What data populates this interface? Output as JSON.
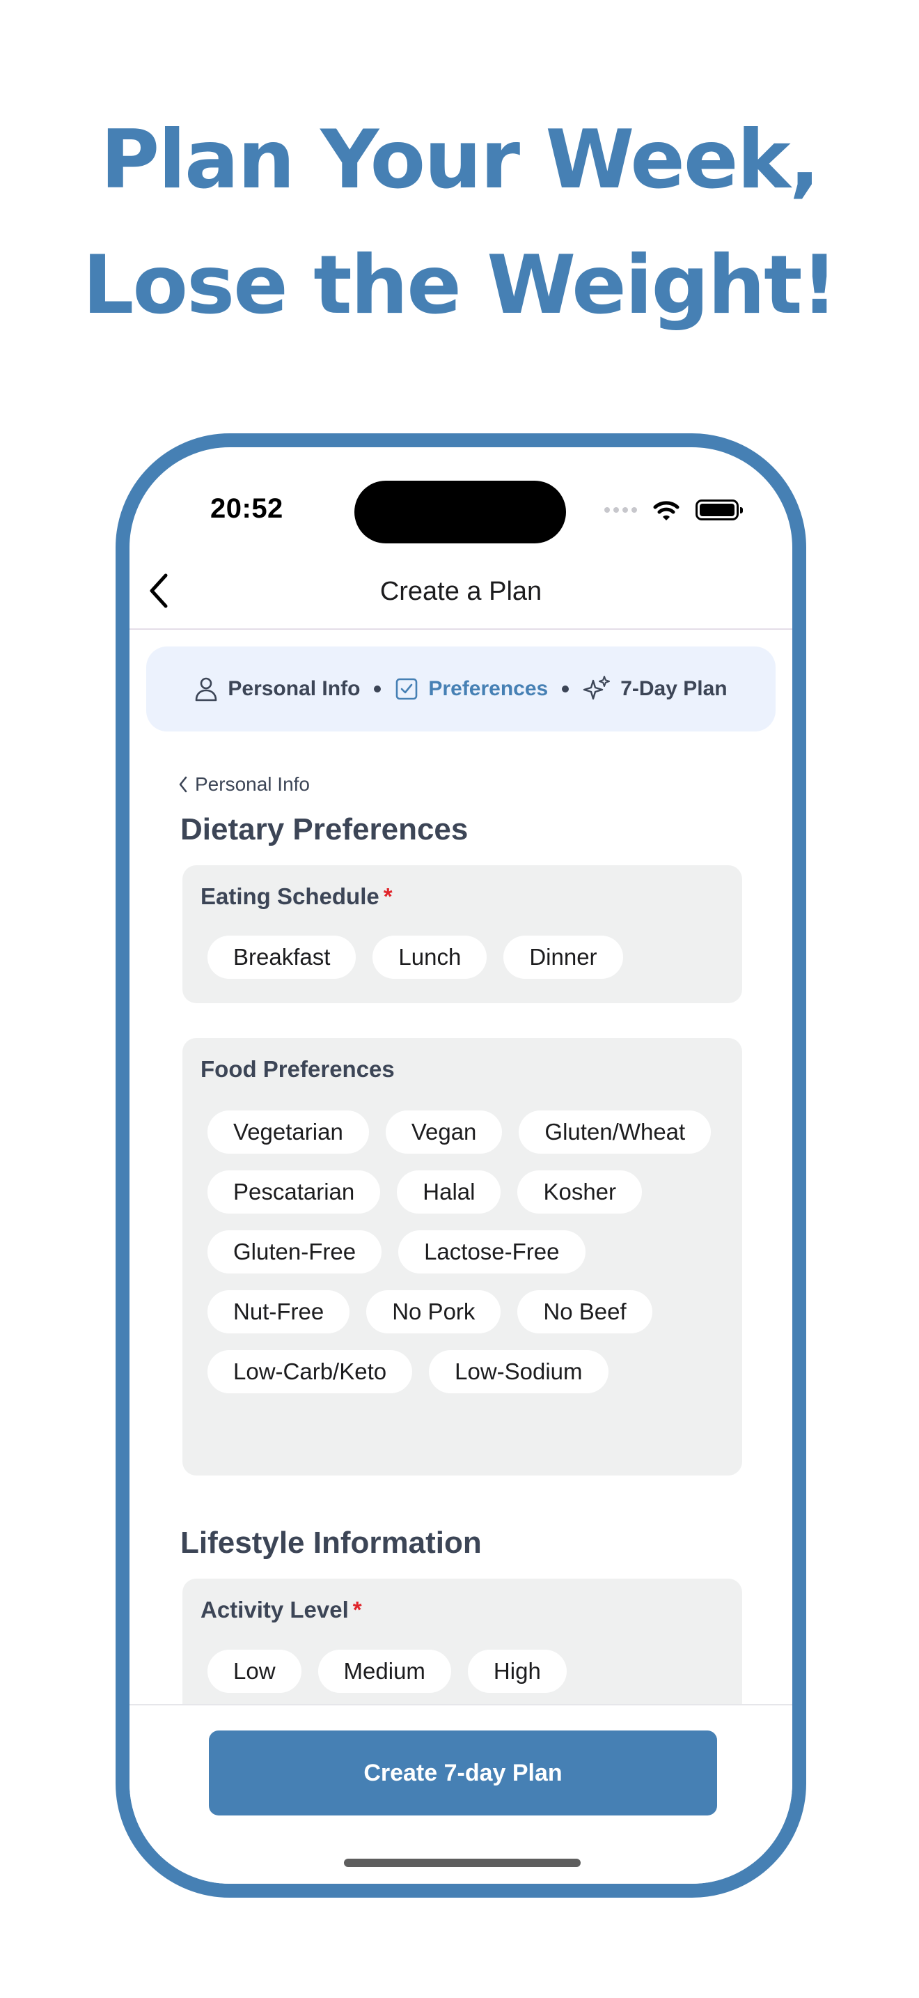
{
  "headline": {
    "line1": "Plan Your Week,",
    "line2": "Lose the Weight!"
  },
  "status_bar": {
    "time": "20:52"
  },
  "nav": {
    "title": "Create a Plan"
  },
  "steps": [
    {
      "label": "Personal Info",
      "icon": "person-icon",
      "active": false
    },
    {
      "label": "Preferences",
      "icon": "checkbox-icon",
      "active": true
    },
    {
      "label": "7-Day Plan",
      "icon": "sparkles-icon",
      "active": false
    }
  ],
  "back_link": {
    "label": "Personal Info"
  },
  "dietary": {
    "title": "Dietary Preferences",
    "eating_schedule": {
      "label": "Eating Schedule",
      "required_mark": "*",
      "options": [
        "Breakfast",
        "Lunch",
        "Dinner"
      ]
    },
    "food_preferences": {
      "label": "Food Preferences",
      "options": [
        "Vegetarian",
        "Vegan",
        "Gluten/Wheat",
        "Pescatarian",
        "Halal",
        "Kosher",
        "Gluten-Free",
        "Lactose-Free",
        "Nut-Free",
        "No Pork",
        "No Beef",
        "Low-Carb/Keto",
        "Low-Sodium"
      ]
    }
  },
  "lifestyle": {
    "title": "Lifestyle Information",
    "activity_level": {
      "label": "Activity Level",
      "required_mark": "*",
      "options": [
        "Low",
        "Medium",
        "High"
      ]
    }
  },
  "cta": {
    "label": "Create 7-day Plan"
  },
  "colors": {
    "brand": "#4680b4",
    "required": "#e0242a",
    "chip_bg": "#ffffff",
    "card_bg": "#eff0f0",
    "stepper_bg": "#ecf2fd"
  }
}
